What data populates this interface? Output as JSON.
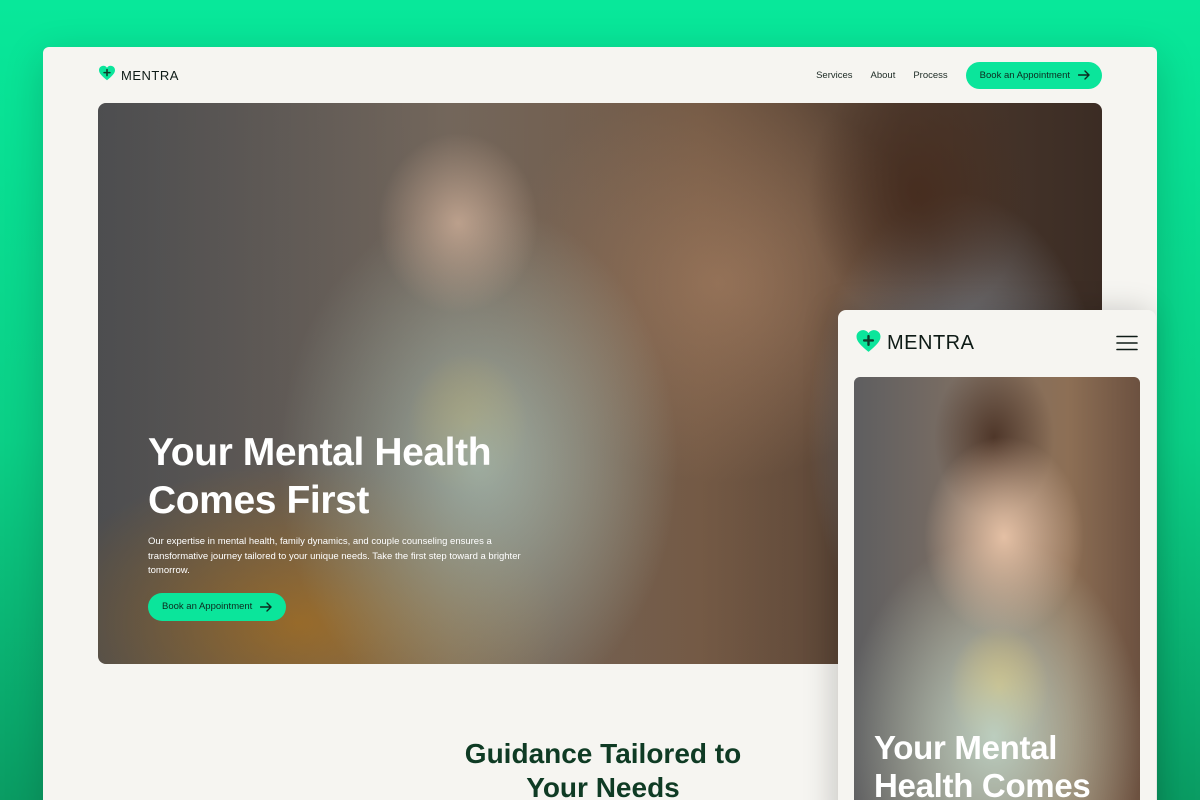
{
  "colors": {
    "accent": "#0be59b",
    "background_gradient_top": "#08e89a",
    "background_gradient_bottom": "#0a9c63",
    "page_bg": "#f6f5f1",
    "heading_green": "#0f3b24"
  },
  "desktop": {
    "brand": {
      "name": "MENTRA",
      "icon": "heart-plus-icon"
    },
    "nav": {
      "links": [
        "Services",
        "About",
        "Process"
      ],
      "cta_label": "Book an Appointment",
      "cta_icon": "arrow-right-icon"
    },
    "hero": {
      "title_line1": "Your Mental Health",
      "title_line2": "Comes First",
      "subtitle": "Our expertise in mental health, family dynamics, and couple counseling ensures a transformative journey tailored to your unique needs. Take the first step toward a brighter tomorrow.",
      "cta_label": "Book an Appointment",
      "cta_icon": "arrow-right-icon"
    },
    "section": {
      "title_line1": "Guidance Tailored to",
      "title_line2": "Your Needs"
    }
  },
  "mobile": {
    "brand": {
      "name": "MENTRA",
      "icon": "heart-plus-icon"
    },
    "menu_icon": "hamburger-menu-icon",
    "hero": {
      "title_line1": "Your Mental",
      "title_line2": "Health Comes"
    }
  }
}
